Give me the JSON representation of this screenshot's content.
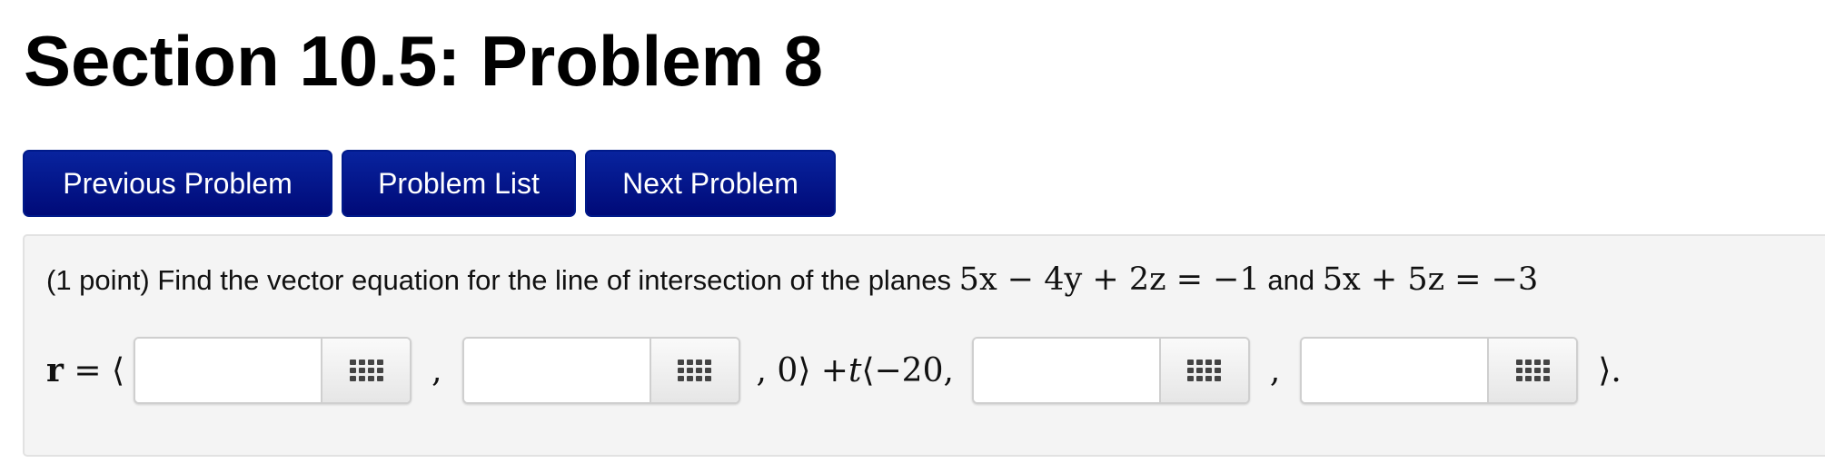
{
  "page": {
    "title": "Section 10.5: Problem 8"
  },
  "nav": {
    "previous_label": "Previous Problem",
    "list_label": "Problem List",
    "next_label": "Next Problem"
  },
  "problem": {
    "statement_text": "(1 point) Find the vector equation for the line of intersection of the planes",
    "plane1": "5x − 4y + 2z = −1",
    "and_text": "and",
    "plane2": "5x + 5z = −3"
  },
  "answer": {
    "r_label": "r",
    "equals_open": " = ⟨",
    "comma": ",",
    "mid_text": ", 0⟩ + ",
    "t_var": "t",
    "dir_start": "⟨−20,",
    "close_text": "⟩.",
    "inputs": [
      {
        "value": "",
        "placeholder": ""
      },
      {
        "value": "",
        "placeholder": ""
      },
      {
        "value": "",
        "placeholder": ""
      },
      {
        "value": "",
        "placeholder": ""
      }
    ],
    "palette_icon": "grid-icon"
  }
}
